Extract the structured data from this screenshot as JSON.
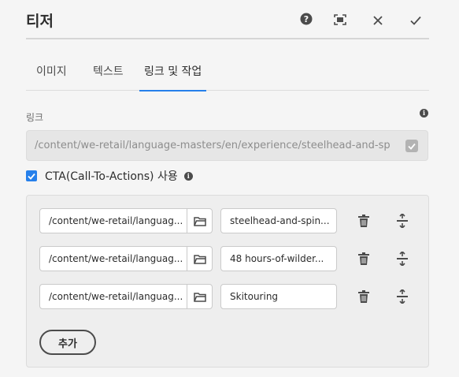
{
  "dialog": {
    "title": "티저"
  },
  "header_icons": [
    "help-icon",
    "fullscreen-icon",
    "close-icon",
    "done-icon"
  ],
  "tabs": [
    {
      "label": "이미지",
      "active": false
    },
    {
      "label": "텍스트",
      "active": false
    },
    {
      "label": "링크 및 작업",
      "active": true
    }
  ],
  "link": {
    "label": "링크",
    "value": "/content/we-retail/language-masters/en/experience/steelhead-and-spines-in-alask"
  },
  "cta": {
    "label": "CTA(Call-To-Actions) 사용",
    "checked": true
  },
  "actions": [
    {
      "path": "/content/we-retail/languag...",
      "text": "steelhead-and-spin..."
    },
    {
      "path": "/content/we-retail/languag...",
      "text": "48 hours-of-wilder..."
    },
    {
      "path": "/content/we-retail/languag...",
      "text": "Skitouring"
    }
  ],
  "add_button": {
    "label": "추가"
  },
  "colors": {
    "accent": "#2680eb",
    "background": "#f5f5f5"
  }
}
